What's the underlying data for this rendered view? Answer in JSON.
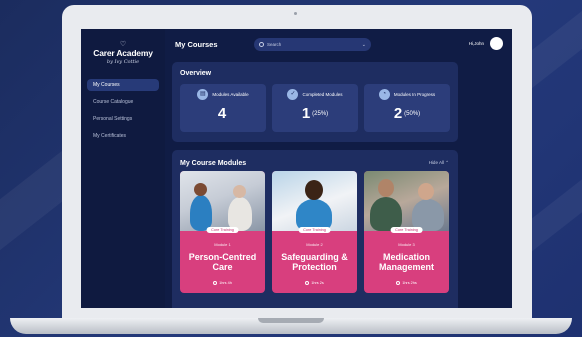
{
  "sidebar": {
    "logo": {
      "name": "Carer Academy",
      "tagline": "by Ivy Cottie"
    },
    "items": [
      {
        "label": "My Courses",
        "active": true
      },
      {
        "label": "Course Catalogue",
        "active": false
      },
      {
        "label": "Personal Settings",
        "active": false
      },
      {
        "label": "My Certificates",
        "active": false
      }
    ]
  },
  "header": {
    "title": "My Courses",
    "search": {
      "placeholder": "Search"
    },
    "greeting": "Hi,John"
  },
  "overview": {
    "title": "Overview",
    "stats": [
      {
        "label": "Modules Available",
        "value": "4",
        "pct": ""
      },
      {
        "label": "Completed Modules",
        "value": "1",
        "pct": "(25%)"
      },
      {
        "label": "Modules In Progress",
        "value": "2",
        "pct": "(50%)"
      }
    ]
  },
  "modules": {
    "title": "My Course Modules",
    "hide_all": "Hide All",
    "cards": [
      {
        "tag": "Core Training",
        "number": "Module 1",
        "title": "Person-Centred Care",
        "time": "1hrs 4h"
      },
      {
        "tag": "Core Training",
        "number": "Module 2",
        "title": "Safeguarding & Protection",
        "time": "1hrs 2s"
      },
      {
        "tag": "Core Training",
        "number": "Module 3",
        "title": "Medication Management",
        "time": "1hrs 2hs"
      }
    ]
  },
  "colors": {
    "accent_pink": "#d83f7e",
    "panel": "#1e2d61",
    "screen_bg": "#101c45"
  }
}
